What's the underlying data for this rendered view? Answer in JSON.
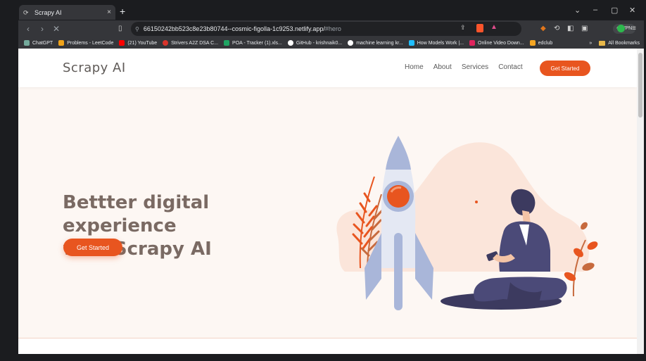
{
  "browser": {
    "tab_title": "Scrapy AI",
    "tab_close": "×",
    "new_tab": "+",
    "window_controls": [
      "⌄",
      "–",
      "▢",
      "✕"
    ],
    "url_host": "66150242bb523c8e23b80744--cosmic-figolla-1c9253.netlify.app/",
    "url_fragment": "#hero",
    "vpn_label": "VPN",
    "bookmarks": [
      {
        "label": "ChatGPT",
        "color": "#74aa9c"
      },
      {
        "label": "Problems - LeetCode",
        "color": "#f0a31a"
      },
      {
        "label": "(21) YouTube",
        "color": "#ff0000"
      },
      {
        "label": "Strivers A2Z DSA C...",
        "color": "#d9342b"
      },
      {
        "label": "POA - Tracker (1).xls...",
        "color": "#1fa463"
      },
      {
        "label": "GitHub - krishnaik0...",
        "color": "#ffffff"
      },
      {
        "label": "machine learning kr...",
        "color": "#ffffff"
      },
      {
        "label": "How Models Work |...",
        "color": "#20beff"
      },
      {
        "label": "Online Video Down...",
        "color": "#e0245e"
      },
      {
        "label": "edclub",
        "color": "#f5a623"
      }
    ],
    "all_bookmarks": "All Bookmarks",
    "bookmarks_overflow": "»"
  },
  "site": {
    "logo": "Scrapy AI",
    "nav": [
      "Home",
      "About",
      "Services",
      "Contact"
    ],
    "nav_cta": "Get Started",
    "hero": {
      "title_line1": "Bettter digital experience",
      "title_line2": "with Scrapy AI",
      "cta": "Get Started"
    }
  },
  "colors": {
    "accent": "#e8551f",
    "hero_bg": "#fdf7f3",
    "title": "#7a6a63"
  }
}
